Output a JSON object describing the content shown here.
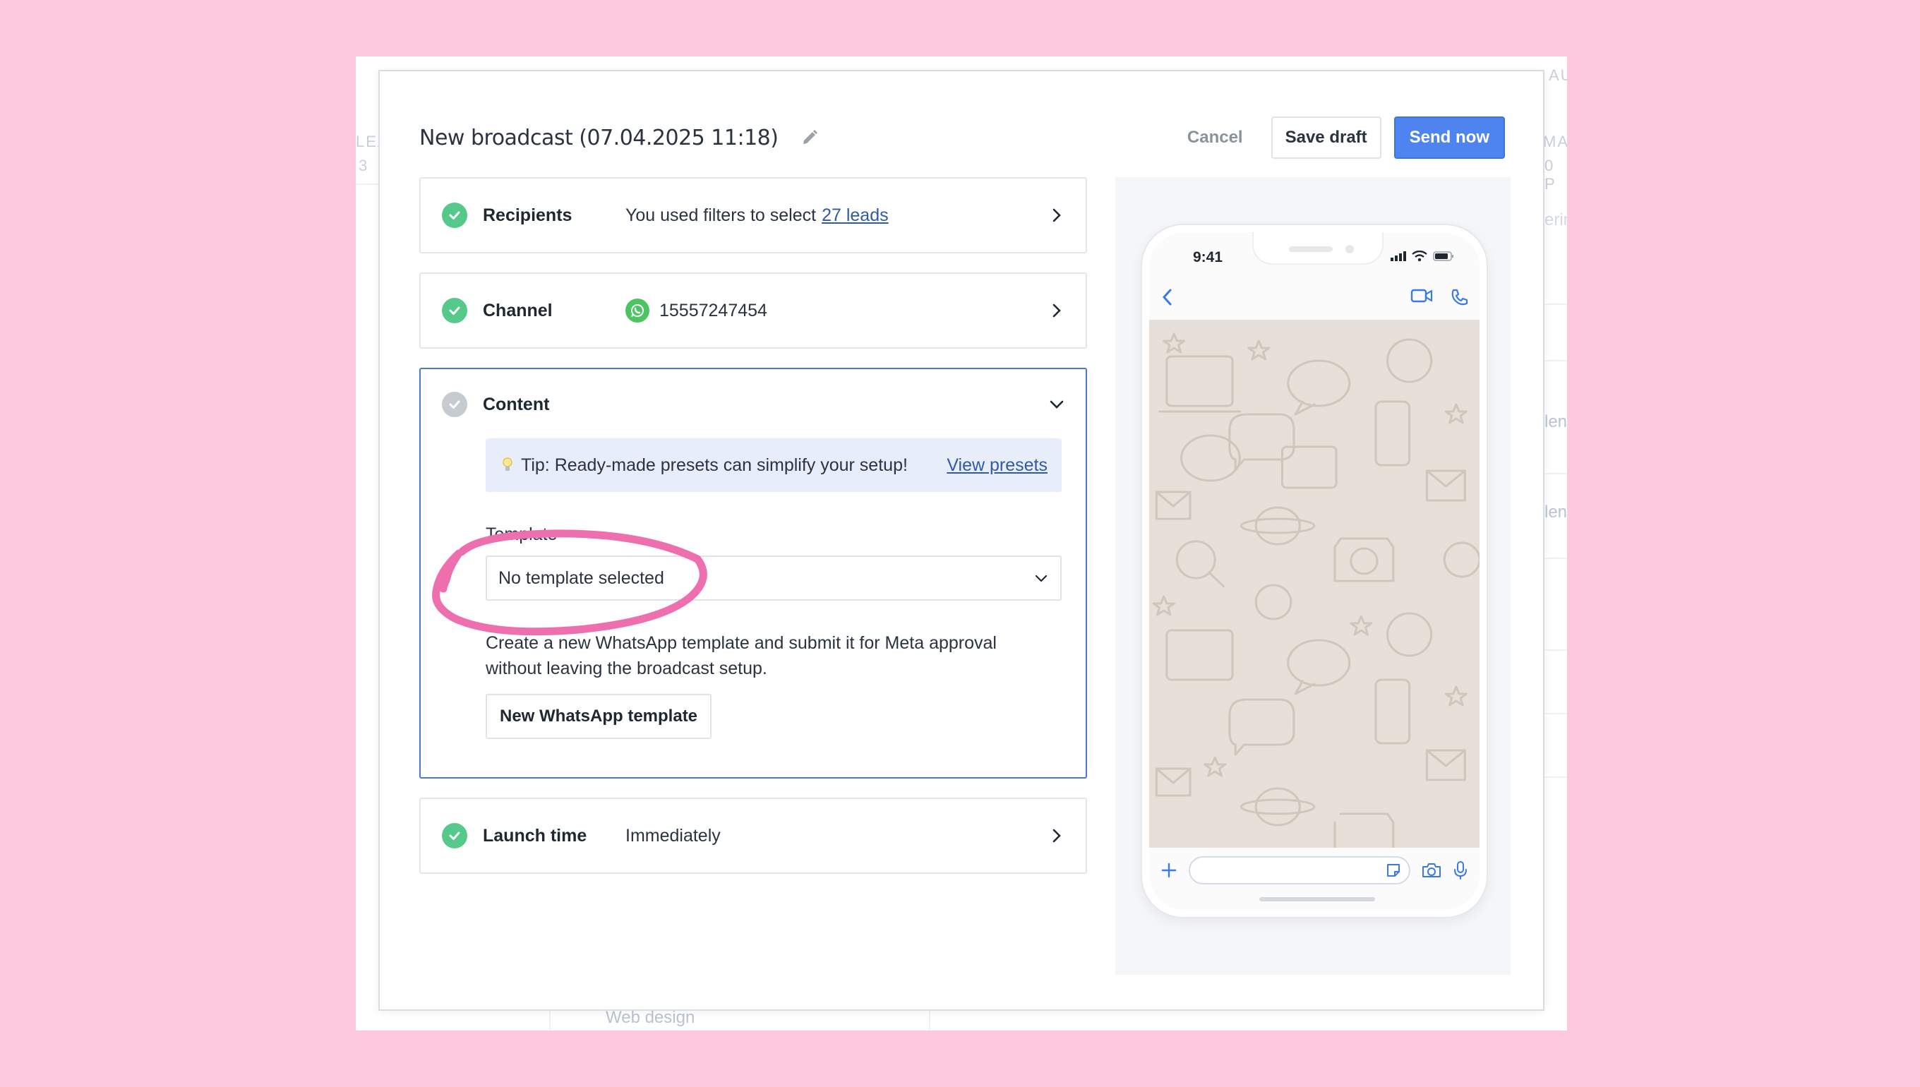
{
  "background_app": {
    "col1_header": "LEA",
    "col1_count": "3",
    "col2_header": "AU",
    "col3_header": "MAI",
    "col3_count": "0 P",
    "side_text_1": "erin",
    "side_text_2": "len",
    "side_text_3": "len",
    "card_text": "Web design"
  },
  "modal": {
    "title": "New broadcast (07.04.2025 11:18)",
    "cancel_label": "Cancel",
    "save_draft_label": "Save draft",
    "send_now_label": "Send now"
  },
  "steps": {
    "recipients": {
      "label": "Recipients",
      "value_prefix": "You used filters to select",
      "value_link": "27 leads"
    },
    "channel": {
      "label": "Channel",
      "value": "15557247454",
      "icon": "whatsapp-icon"
    },
    "content": {
      "label": "Content",
      "tip_text": "Tip: Ready-made presets can simplify your setup!",
      "tip_link": "View presets",
      "template_label": "Template",
      "template_value": "No template selected",
      "help_text": "Create a new WhatsApp template and submit it for Meta approval without leaving the broadcast setup.",
      "new_template_button": "New WhatsApp template"
    },
    "launch_time": {
      "label": "Launch time",
      "value": "Immediately"
    }
  },
  "phone_preview": {
    "time": "9:41"
  },
  "colors": {
    "accent": "#4d84f0",
    "success": "#55c98a",
    "annotation": "#ee6fae",
    "page_background": "#fdc9df"
  }
}
